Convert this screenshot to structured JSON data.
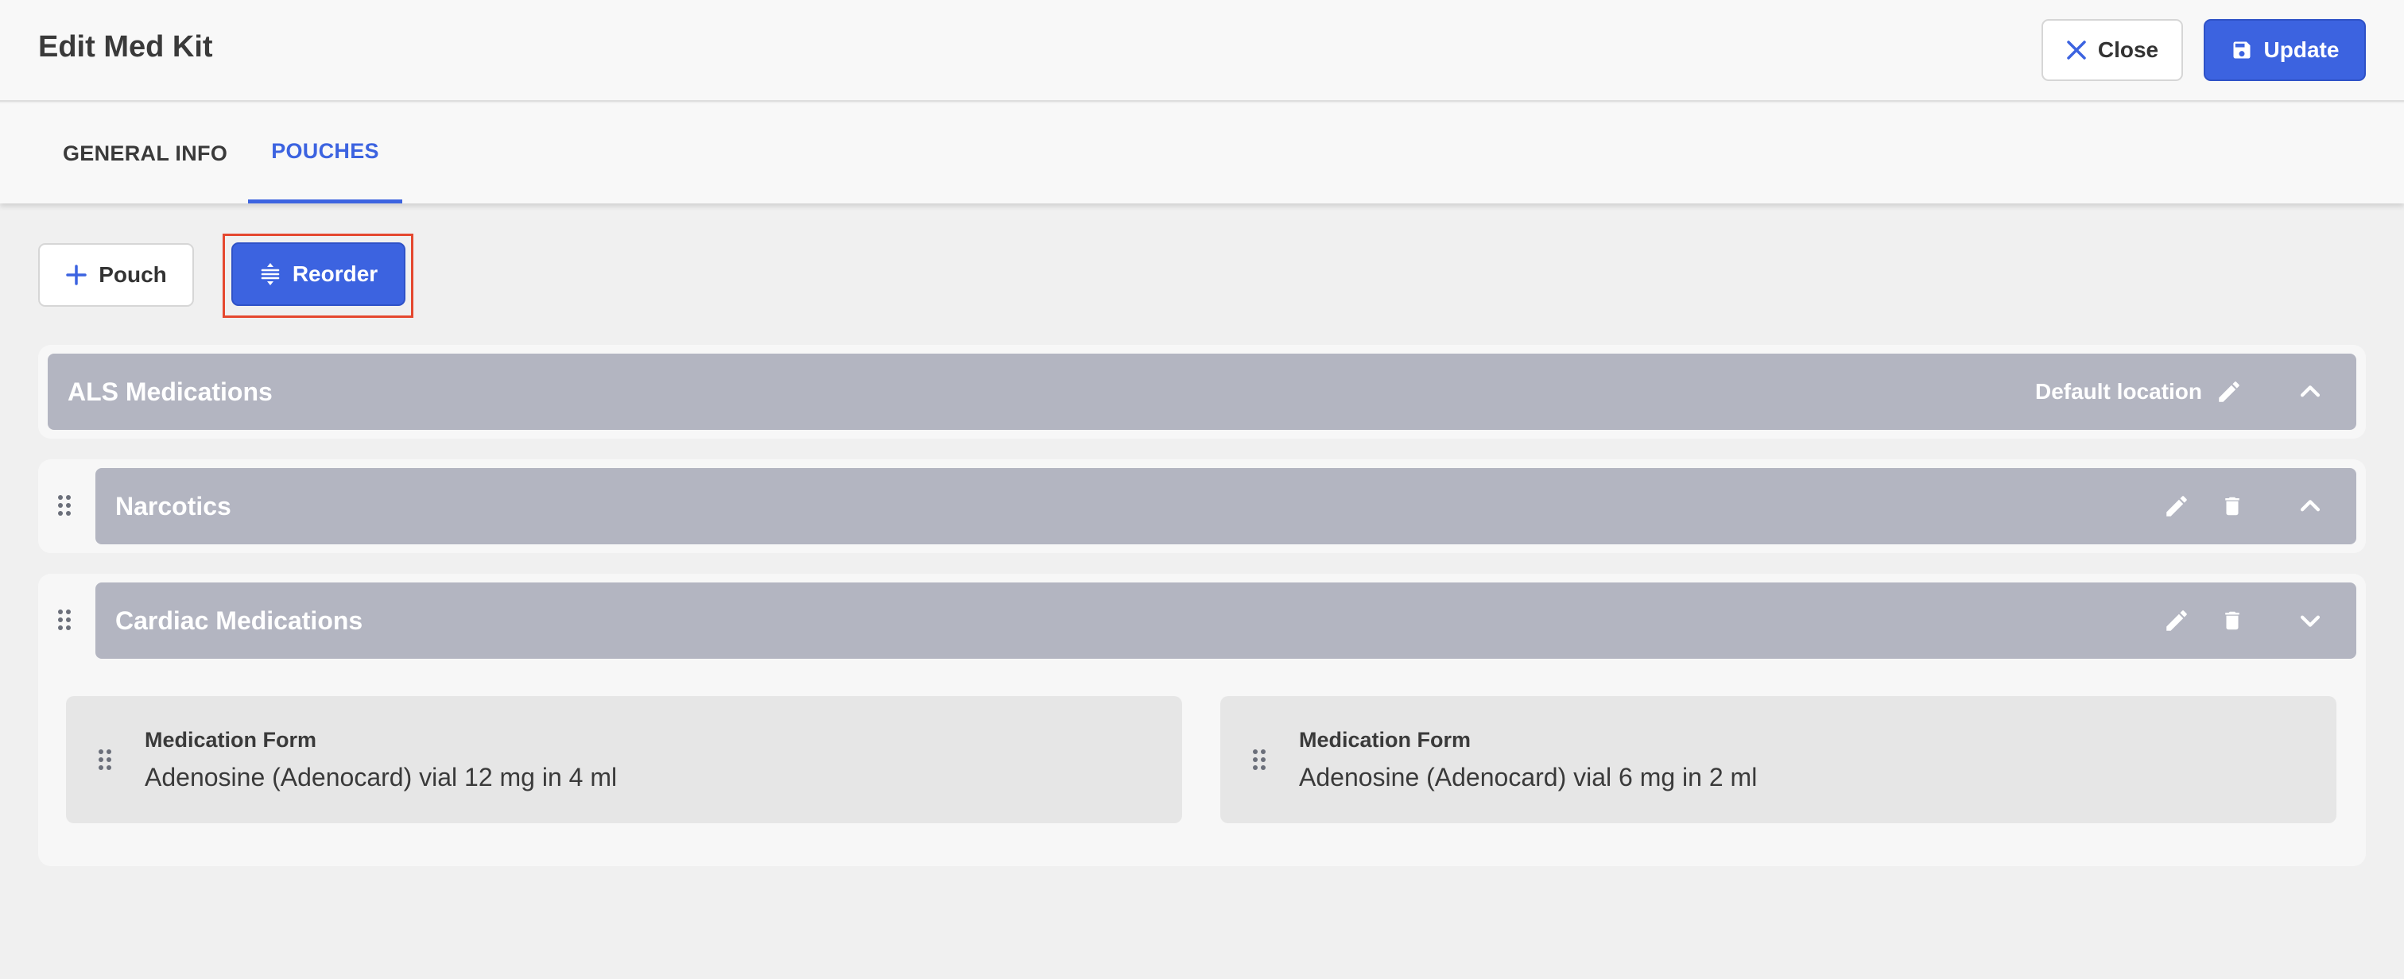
{
  "header": {
    "title": "Edit Med Kit",
    "close_label": "Close",
    "update_label": "Update"
  },
  "tabs": [
    {
      "label": "GENERAL INFO",
      "active": false
    },
    {
      "label": "POUCHES",
      "active": true
    }
  ],
  "toolbar": {
    "add_pouch_label": "Pouch",
    "reorder_label": "Reorder"
  },
  "pouches": [
    {
      "name": "ALS Medications",
      "location": "Default location",
      "expanded": true
    },
    {
      "name": "Narcotics",
      "expanded": true
    },
    {
      "name": "Cardiac Medications",
      "expanded": false,
      "items": [
        {
          "label": "Medication Form",
          "value": "Adenosine (Adenocard) vial 12 mg in 4 ml"
        },
        {
          "label": "Medication Form",
          "value": "Adenosine (Adenocard) vial 6 mg in 2 ml"
        }
      ]
    }
  ],
  "colors": {
    "accent": "#3c63e0",
    "pouch_bar": "#b3b5c1",
    "highlight": "#e5482f"
  },
  "icons": [
    "close-icon",
    "save-icon",
    "plus-icon",
    "reorder-icon",
    "edit-icon",
    "trash-icon",
    "chevron-up-icon",
    "chevron-down-icon",
    "drag-handle-icon"
  ]
}
